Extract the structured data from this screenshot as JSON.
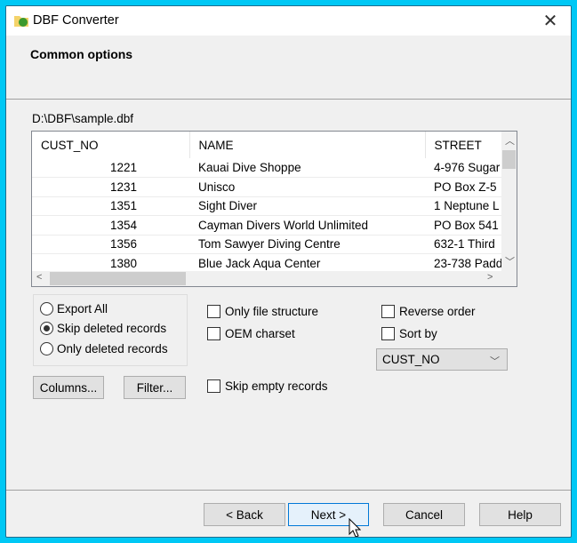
{
  "window": {
    "title": "DBF Converter"
  },
  "header": {
    "title": "Common options"
  },
  "file_path": "D:\\DBF\\sample.dbf",
  "table": {
    "columns": [
      "CUST_NO",
      "NAME",
      "STREET"
    ],
    "rows": [
      [
        "1221",
        "Kauai Dive Shoppe",
        "4-976 Sugar"
      ],
      [
        "1231",
        "Unisco",
        "PO Box Z-5"
      ],
      [
        "1351",
        "Sight Diver",
        "1 Neptune L"
      ],
      [
        "1354",
        "Cayman Divers World Unlimited",
        "PO Box 541"
      ],
      [
        "1356",
        "Tom Sawyer Diving Centre",
        "632-1 Third"
      ],
      [
        "1380",
        "Blue Jack Aqua Center",
        "23-738 Padd"
      ]
    ]
  },
  "export_mode": {
    "options": [
      "Export All",
      "Skip deleted records",
      "Only deleted records"
    ],
    "selected": "Skip deleted records"
  },
  "options": {
    "only_file_structure": {
      "label": "Only file structure",
      "checked": false
    },
    "oem_charset": {
      "label": "OEM charset",
      "checked": false
    },
    "skip_empty_records": {
      "label": "Skip empty records",
      "checked": false
    },
    "reverse_order": {
      "label": "Reverse order",
      "checked": false
    },
    "sort_by": {
      "label": "Sort by",
      "checked": false,
      "value": "CUST_NO"
    }
  },
  "buttons": {
    "columns": "Columns...",
    "filter": "Filter...",
    "back": "< Back",
    "next": "Next >",
    "cancel": "Cancel",
    "help": "Help"
  }
}
